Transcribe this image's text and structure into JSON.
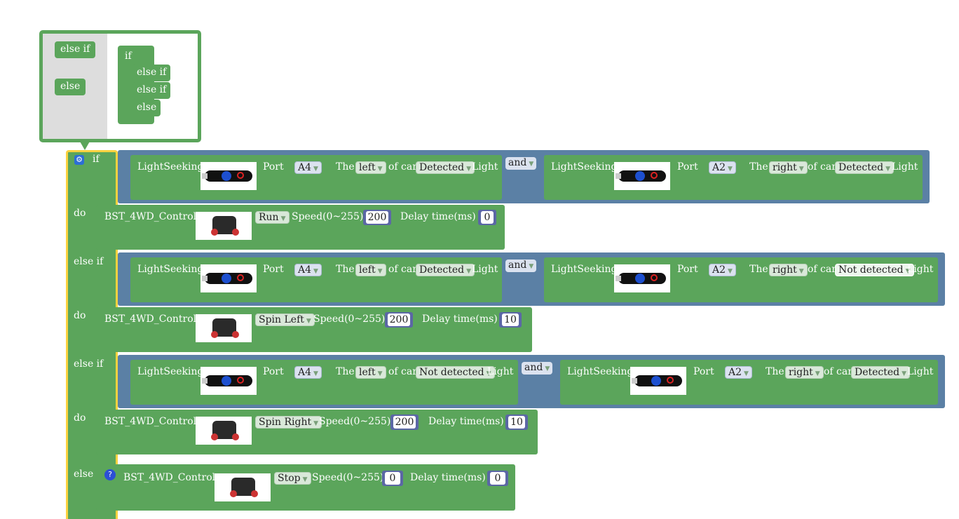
{
  "mutator": {
    "palette": [
      "else if",
      "else"
    ],
    "container": {
      "head": "if",
      "items": [
        "else if",
        "else if",
        "else"
      ]
    }
  },
  "main": {
    "if_label": "if",
    "do_label": "do",
    "elseif_label": "else if",
    "else_label": "else"
  },
  "sensor": {
    "title": "LightSeeking",
    "port": "Port",
    "the": "The",
    "of_car": "of car",
    "light": "Light",
    "and": "and"
  },
  "conditions": [
    {
      "left": {
        "port": "A4",
        "side": "left",
        "state": "Detected"
      },
      "right": {
        "port": "A2",
        "side": "right",
        "state": "Detected"
      }
    },
    {
      "left": {
        "port": "A4",
        "side": "left",
        "state": "Detected"
      },
      "right": {
        "port": "A2",
        "side": "right",
        "state": "Not detected"
      }
    },
    {
      "left": {
        "port": "A4",
        "side": "left",
        "state": "Not detected"
      },
      "right": {
        "port": "A2",
        "side": "right",
        "state": "Detected"
      }
    }
  ],
  "control": {
    "title": "BST_4WD_Control",
    "speed": "Speed(0~255)",
    "delay": "Delay time(ms)"
  },
  "actions": [
    {
      "mode": "Run",
      "speed": "200",
      "delay": "0"
    },
    {
      "mode": "Spin Left",
      "speed": "200",
      "delay": "10"
    },
    {
      "mode": "Spin Right",
      "speed": "200",
      "delay": "10"
    },
    {
      "mode": "Stop",
      "speed": "0",
      "delay": "0"
    }
  ],
  "icons": {
    "gear": "gear-icon",
    "help": "help-icon",
    "dropdown": "dropdown-arrow-icon"
  },
  "colors": {
    "logic": "#5ba55b",
    "bool": "#5b80a5",
    "number": "#5b67a5",
    "selected": "#fbd240"
  }
}
